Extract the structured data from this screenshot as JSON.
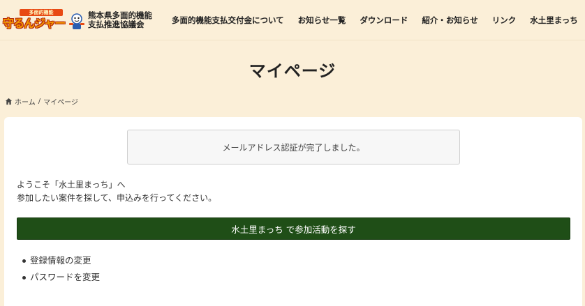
{
  "header": {
    "logo_badge": "多面的機能",
    "logo_main": "守るんジャー",
    "logo_text_line1": "熊本県多面的機能",
    "logo_text_line2": "支払推進協議会"
  },
  "nav": {
    "items": [
      {
        "label": "多面的機能支払交付金について"
      },
      {
        "label": "お知らせ一覧"
      },
      {
        "label": "ダウンロード"
      },
      {
        "label": "紹介・お知らせ"
      },
      {
        "label": "リンク"
      },
      {
        "label": "水土里まっち"
      }
    ]
  },
  "page": {
    "title": "マイページ"
  },
  "breadcrumb": {
    "home": "ホーム",
    "separator": "/",
    "current": "マイページ"
  },
  "notice": {
    "message": "メールアドレス認証が完了しました。"
  },
  "welcome": {
    "line1": "ようこそ「水土里まっち」へ",
    "line2": "参加したい案件を探して、申込みを行ってください。"
  },
  "search_button": {
    "label": "水土里まっち で参加活動を探す"
  },
  "links": [
    {
      "label": "登録情報の変更"
    },
    {
      "label": "パスワードを変更"
    }
  ],
  "colors": {
    "background": "#fbefd8",
    "card": "#ffffff",
    "button": "#1f4e17",
    "logo_orange": "#f39800",
    "logo_red": "#e84a14"
  }
}
